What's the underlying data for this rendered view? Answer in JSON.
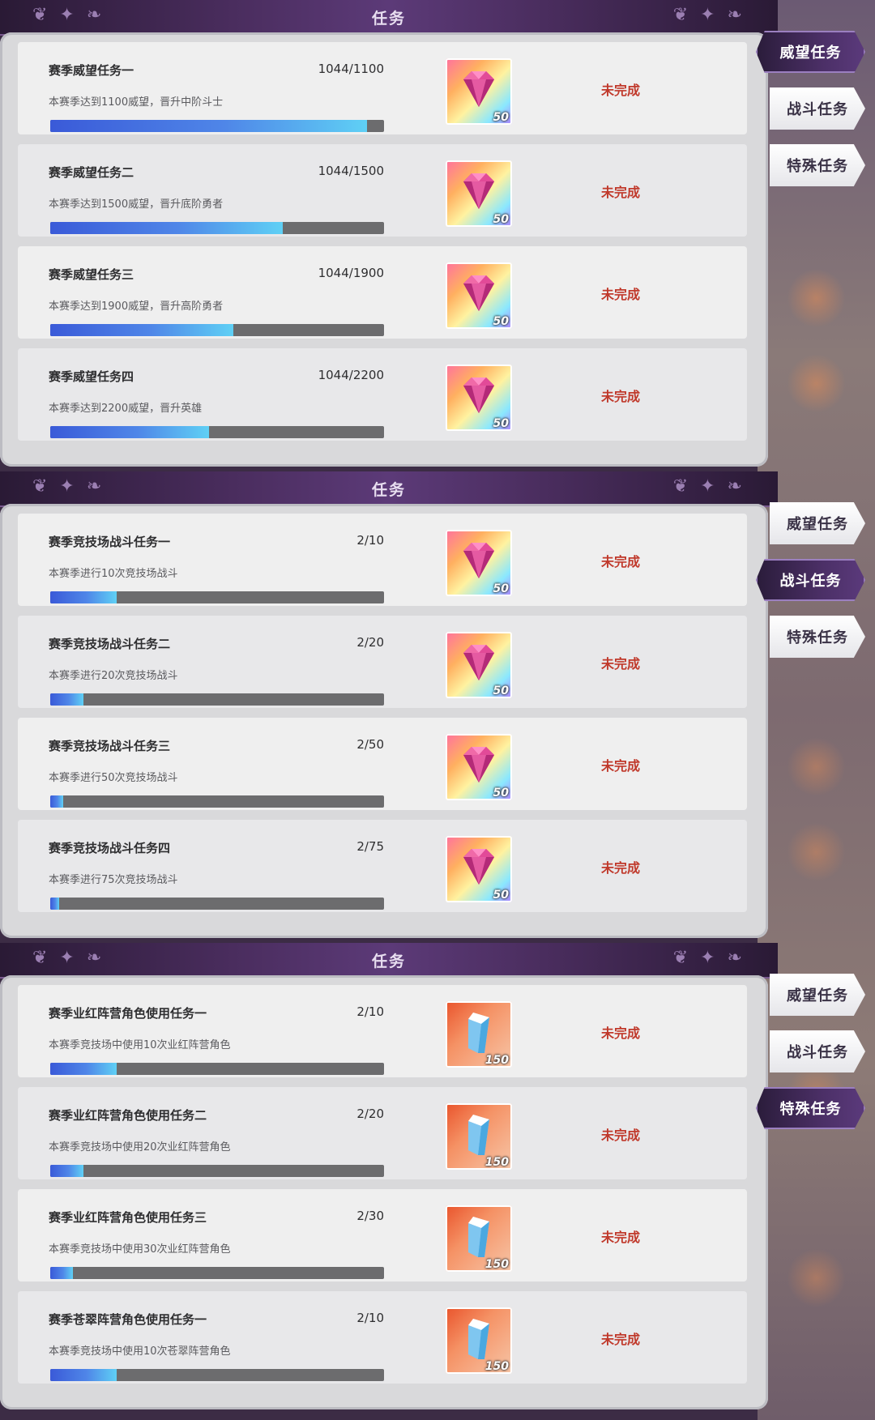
{
  "panels": [
    {
      "title": "任务",
      "tabs": [
        {
          "label": "威望任务",
          "active": true
        },
        {
          "label": "战斗任务",
          "active": false
        },
        {
          "label": "特殊任务",
          "active": false
        }
      ],
      "tasks": [
        {
          "name": "赛季威望任务一",
          "count": "1044/1100",
          "desc": "本赛季达到1100威望，晋升中阶斗士",
          "progress": 0.949,
          "reward_qty": "50",
          "reward_icon": "gem-icon",
          "status": "未完成"
        },
        {
          "name": "赛季威望任务二",
          "count": "1044/1500",
          "desc": "本赛季达到1500威望，晋升底阶勇者",
          "progress": 0.696,
          "reward_qty": "50",
          "reward_icon": "gem-icon",
          "status": "未完成"
        },
        {
          "name": "赛季威望任务三",
          "count": "1044/1900",
          "desc": "本赛季达到1900威望，晋升高阶勇者",
          "progress": 0.549,
          "reward_qty": "50",
          "reward_icon": "gem-icon",
          "status": "未完成"
        },
        {
          "name": "赛季威望任务四",
          "count": "1044/2200",
          "desc": "本赛季达到2200威望，晋升英雄",
          "progress": 0.475,
          "reward_qty": "50",
          "reward_icon": "gem-icon",
          "status": "未完成"
        }
      ]
    },
    {
      "title": "任务",
      "tabs": [
        {
          "label": "威望任务",
          "active": false
        },
        {
          "label": "战斗任务",
          "active": true
        },
        {
          "label": "特殊任务",
          "active": false
        }
      ],
      "tasks": [
        {
          "name": "赛季竞技场战斗任务一",
          "count": "2/10",
          "desc": "本赛季进行10次竞技场战斗",
          "progress": 0.2,
          "reward_qty": "50",
          "reward_icon": "gem-icon",
          "status": "未完成"
        },
        {
          "name": "赛季竞技场战斗任务二",
          "count": "2/20",
          "desc": "本赛季进行20次竞技场战斗",
          "progress": 0.1,
          "reward_qty": "50",
          "reward_icon": "gem-icon",
          "status": "未完成"
        },
        {
          "name": "赛季竞技场战斗任务三",
          "count": "2/50",
          "desc": "本赛季进行50次竞技场战斗",
          "progress": 0.04,
          "reward_qty": "50",
          "reward_icon": "gem-icon",
          "status": "未完成"
        },
        {
          "name": "赛季竞技场战斗任务四",
          "count": "2/75",
          "desc": "本赛季进行75次竞技场战斗",
          "progress": 0.027,
          "reward_qty": "50",
          "reward_icon": "gem-icon",
          "status": "未完成"
        }
      ]
    },
    {
      "title": "任务",
      "tabs": [
        {
          "label": "威望任务",
          "active": false
        },
        {
          "label": "战斗任务",
          "active": false
        },
        {
          "label": "特殊任务",
          "active": true
        }
      ],
      "tasks": [
        {
          "name": "赛季业红阵营角色使用任务一",
          "count": "2/10",
          "desc": "本赛季竞技场中使用10次业红阵营角色",
          "progress": 0.2,
          "reward_qty": "150",
          "reward_icon": "crystal-icon",
          "status": "未完成"
        },
        {
          "name": "赛季业红阵营角色使用任务二",
          "count": "2/20",
          "desc": "本赛季竞技场中使用20次业红阵营角色",
          "progress": 0.1,
          "reward_qty": "150",
          "reward_icon": "crystal-icon",
          "status": "未完成"
        },
        {
          "name": "赛季业红阵营角色使用任务三",
          "count": "2/30",
          "desc": "本赛季竞技场中使用30次业红阵营角色",
          "progress": 0.067,
          "reward_qty": "150",
          "reward_icon": "crystal-icon",
          "status": "未完成"
        },
        {
          "name": "赛季苍翠阵营角色使用任务一",
          "count": "2/10",
          "desc": "本赛季竞技场中使用10次苍翠阵营角色",
          "progress": 0.2,
          "reward_qty": "150",
          "reward_icon": "crystal-icon",
          "status": "未完成"
        }
      ]
    }
  ],
  "colors": {
    "status_incomplete": "#c0392b",
    "progress_fill": "#4f86e8",
    "tab_active": "#4b2f66"
  }
}
